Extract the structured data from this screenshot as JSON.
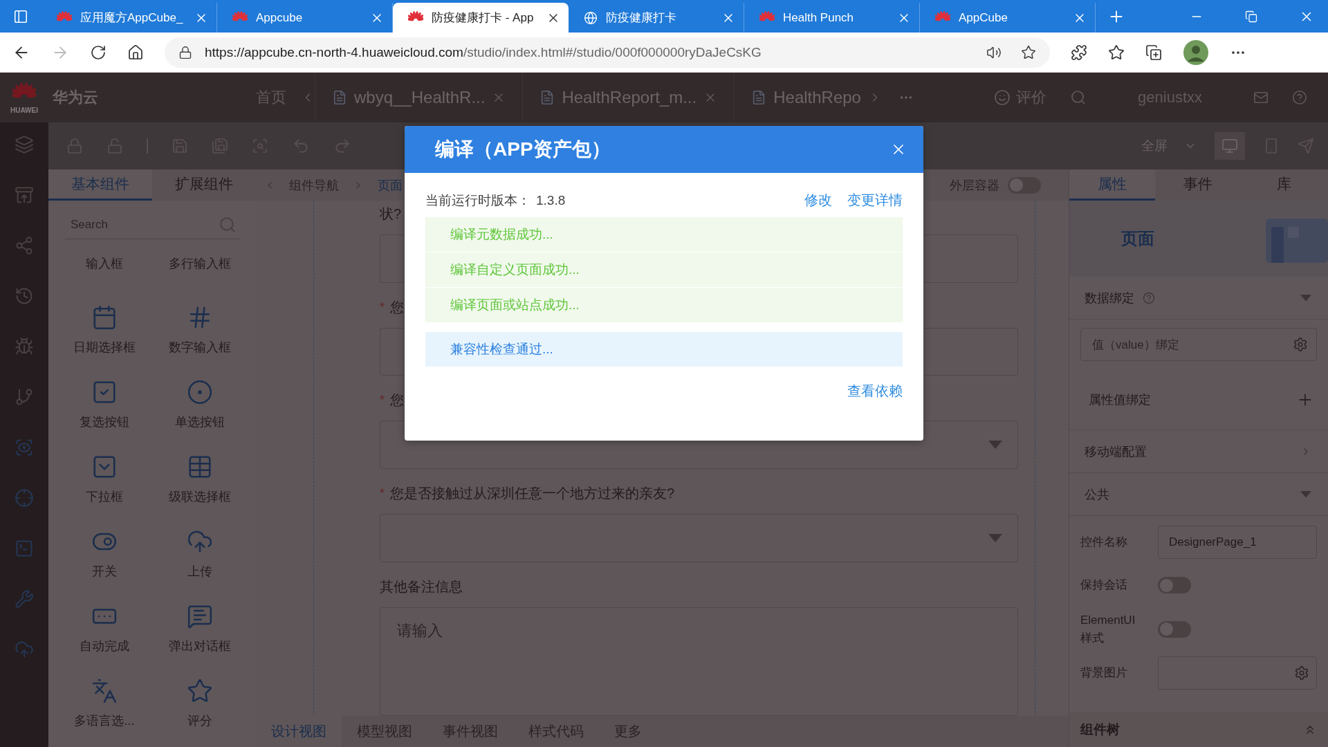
{
  "browser": {
    "tabs": [
      {
        "title": "应用魔方AppCube_",
        "kind": "huawei",
        "selected": false
      },
      {
        "title": "Appcube",
        "kind": "huawei",
        "selected": false
      },
      {
        "title": "防疫健康打卡 - App",
        "kind": "huawei",
        "selected": true
      },
      {
        "title": "防疫健康打卡",
        "kind": "globe",
        "selected": false
      },
      {
        "title": "Health Punch",
        "kind": "huawei",
        "selected": false
      },
      {
        "title": "AppCube",
        "kind": "huawei",
        "selected": false
      }
    ],
    "url_host": "https://appcube.cn-north-4.huaweicloud.com",
    "url_path": "/studio/index.html#/studio/000f000000ryDaJeCsKG"
  },
  "app_header": {
    "logo_text": "HUAWEI",
    "brand": "华为云",
    "home": "首页",
    "editor_tabs": [
      {
        "label": "wbyq__HealthR...",
        "kind": "closable"
      },
      {
        "label": "HealthReport_m...",
        "kind": "closable"
      },
      {
        "label": "HealthRepo",
        "kind": "overflow"
      }
    ],
    "rate": "评价",
    "user": "geniustxx"
  },
  "toolbar": {
    "fullscreen": "全屏"
  },
  "left_panel": {
    "tabs": [
      {
        "label": "基本组件",
        "selected": true
      },
      {
        "label": "扩展组件",
        "selected": false
      }
    ],
    "search_placeholder": "Search",
    "components": [
      {
        "label": "输入框",
        "kind": "none"
      },
      {
        "label": "多行输入框",
        "kind": "none"
      },
      {
        "label": "日期选择框",
        "kind": "calendar"
      },
      {
        "label": "数字输入框",
        "kind": "number"
      },
      {
        "label": "复选按钮",
        "kind": "checkbox"
      },
      {
        "label": "单选按钮",
        "kind": "radio"
      },
      {
        "label": "下拉框",
        "kind": "select"
      },
      {
        "label": "级联选择框",
        "kind": "cascader"
      },
      {
        "label": "开关",
        "kind": "switch"
      },
      {
        "label": "上传",
        "kind": "upload"
      },
      {
        "label": "自动完成",
        "kind": "autocomplete"
      },
      {
        "label": "弹出对话框",
        "kind": "dialog"
      },
      {
        "label": "多语言选...",
        "kind": "i18n"
      },
      {
        "label": "评分",
        "kind": "rate"
      }
    ]
  },
  "canvas": {
    "breadcrumb": [
      "组件导航",
      "页面"
    ],
    "outer_container": {
      "label": "外层容器",
      "on": false
    },
    "form": [
      {
        "kind": "label",
        "text": "状?"
      },
      {
        "kind": "input"
      },
      {
        "kind": "label",
        "mark": "*",
        "text": "您"
      },
      {
        "kind": "input"
      },
      {
        "kind": "label",
        "mark": "*",
        "text": "您"
      },
      {
        "kind": "select"
      },
      {
        "kind": "label",
        "mark": "*",
        "text": "您是否接触过从深圳任意一个地方过来的亲友?"
      },
      {
        "kind": "select"
      },
      {
        "kind": "label",
        "text": "其他备注信息"
      },
      {
        "kind": "textarea",
        "placeholder": "请输入"
      }
    ],
    "bottom_tabs": [
      {
        "label": "设计视图",
        "selected": true
      },
      {
        "label": "模型视图",
        "selected": false
      },
      {
        "label": "事件视图",
        "selected": false
      },
      {
        "label": "样式代码",
        "selected": false
      },
      {
        "label": "更多",
        "selected": false
      }
    ]
  },
  "right_panel": {
    "tabs": [
      {
        "label": "属性",
        "selected": true
      },
      {
        "label": "事件",
        "selected": false
      },
      {
        "label": "库",
        "selected": false
      }
    ],
    "title": "页面",
    "data_binding": {
      "label": "数据绑定",
      "expanded": true,
      "placeholder": "值（value）绑定",
      "attr_binding": "属性值绑定"
    },
    "mobile": {
      "label": "移动端配置",
      "expanded": false
    },
    "common": {
      "label": "公共",
      "expanded": true,
      "props": [
        {
          "kind": "text",
          "label": "控件名称",
          "value": "DesignerPage_1"
        },
        {
          "kind": "toggle",
          "label": "保持会话",
          "on": false
        },
        {
          "kind": "toggle",
          "label": "ElementUI样式",
          "on": false
        },
        {
          "kind": "picker",
          "label": "背景图片"
        }
      ]
    },
    "tree_title": "组件树"
  },
  "modal": {
    "title": "编译（APP资产包）",
    "version_label": "当前运行时版本：",
    "version": "1.3.8",
    "links": [
      "修改",
      "变更详情"
    ],
    "messages": [
      {
        "kind": "success",
        "text": "编译元数据成功..."
      },
      {
        "kind": "success",
        "text": "编译自定义页面成功..."
      },
      {
        "kind": "success",
        "text": "编译页面或站点成功..."
      },
      {
        "kind": "info",
        "text": "兼容性检查通过..."
      }
    ],
    "footer_link": "查看依赖"
  }
}
